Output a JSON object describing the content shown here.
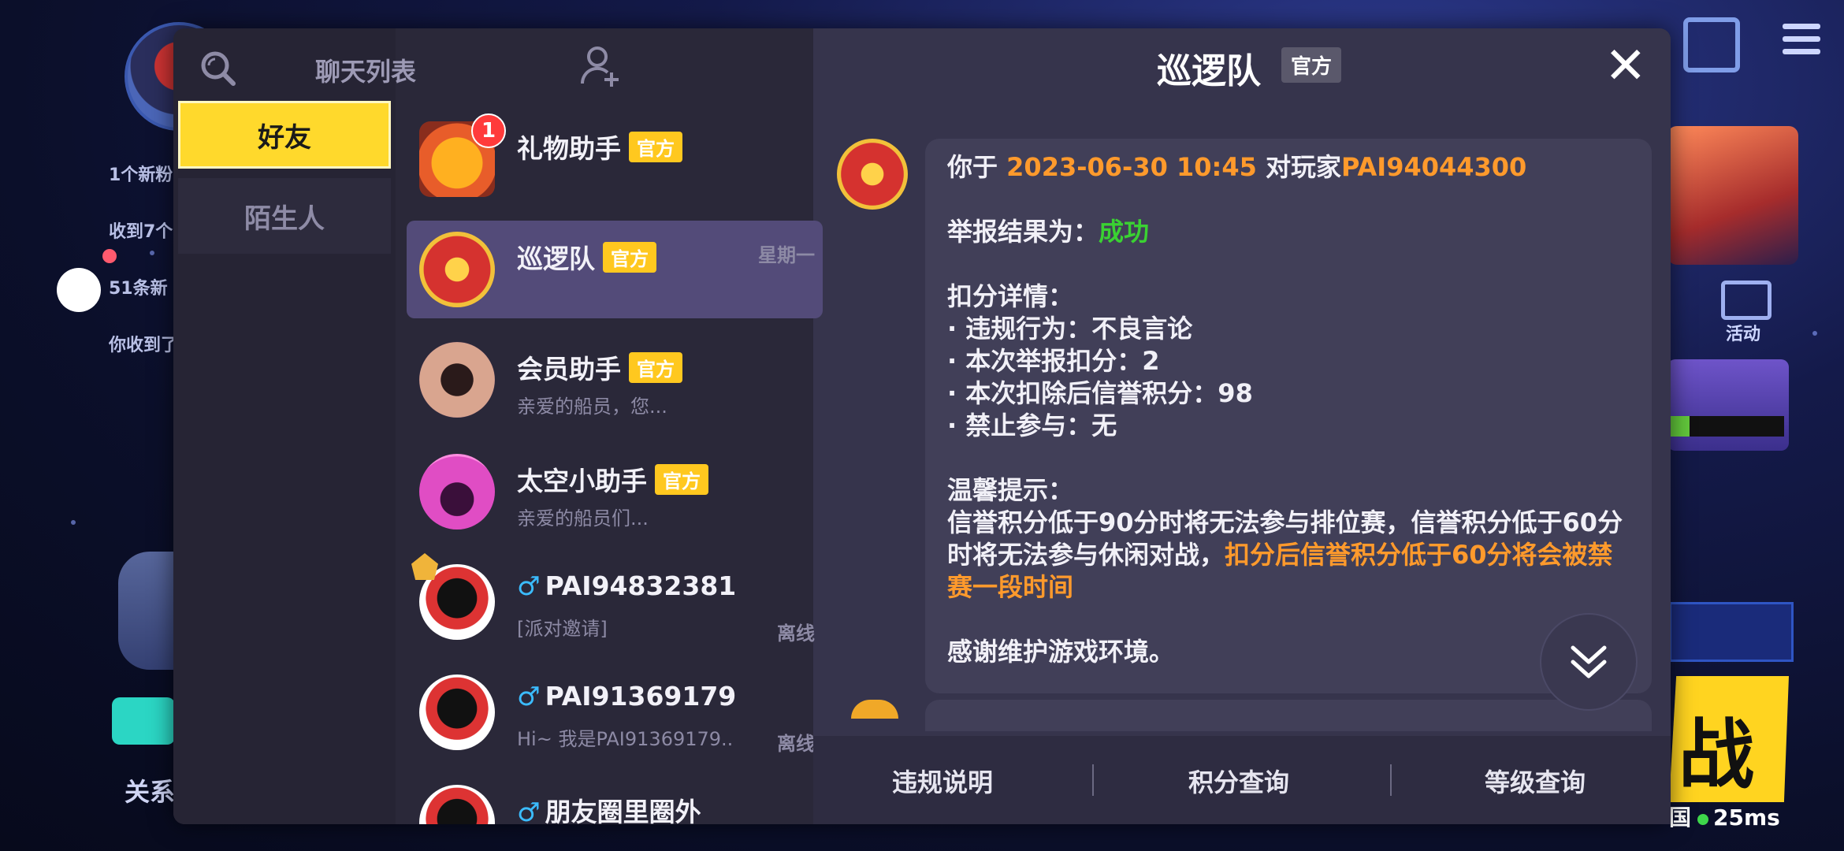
{
  "background": {
    "feed": [
      "1个新粉",
      "收到7个",
      "51条新",
      "你收到了"
    ],
    "guanxi_label": "关系",
    "activity_label": "活动",
    "zhan_text": "战",
    "ping": "25ms",
    "ping_prefix": "国"
  },
  "tabs": {
    "friends": "好友",
    "strangers": "陌生人"
  },
  "chat_list": {
    "title": "聊天列表",
    "items": [
      {
        "name": "礼物助手",
        "badge": "官方",
        "preview": "",
        "meta": "",
        "unread": "1"
      },
      {
        "name": "巡逻队",
        "badge": "官方",
        "preview": "",
        "meta": "星期一"
      },
      {
        "name": "会员助手",
        "badge": "官方",
        "preview": "亲爱的船员，您...",
        "meta": ""
      },
      {
        "name": "太空小助手",
        "badge": "官方",
        "preview": "亲爱的船员们...",
        "meta": ""
      },
      {
        "gender": "♂",
        "name": "PAI94832381",
        "preview": "[派对邀请]",
        "meta": "离线"
      },
      {
        "gender": "♂",
        "name": "PAI91369179",
        "preview": "Hi~ 我是PAI91369179..",
        "meta": "离线"
      },
      {
        "gender": "♂",
        "name": "朋友圈里圈外",
        "preview": "",
        "meta": ""
      }
    ]
  },
  "chat": {
    "title": "巡逻队",
    "badge": "官方",
    "message": {
      "line1_prefix": "你于 ",
      "datetime": "2023-06-30 10:45",
      "line1_mid": " 对玩家",
      "player": "PAI94044300",
      "result_label": "举报结果为：",
      "result_value": "成功",
      "detail_title": "扣分详情：",
      "details": [
        "·  违规行为：不良言论",
        "·  本次举报扣分：2",
        "·  本次扣除后信誉积分：98",
        "·  禁止参与：无"
      ],
      "tip_title": "温馨提示：",
      "tip_text": "信誉积分低于90分时将无法参与排位赛，信誉积分低于60分时将无法参与休闲对战，",
      "tip_warning": "扣分后信誉积分低于60分将会被禁赛一段时间",
      "thanks": "感谢维护游戏环境。"
    }
  },
  "footer": {
    "btn1": "违规说明",
    "btn2": "积分查询",
    "btn3": "等级查询"
  },
  "colors": {
    "accent_yellow": "#ffd92c",
    "orange": "#ff9a2c",
    "green": "#3ad232",
    "male_blue": "#3bbcff"
  }
}
